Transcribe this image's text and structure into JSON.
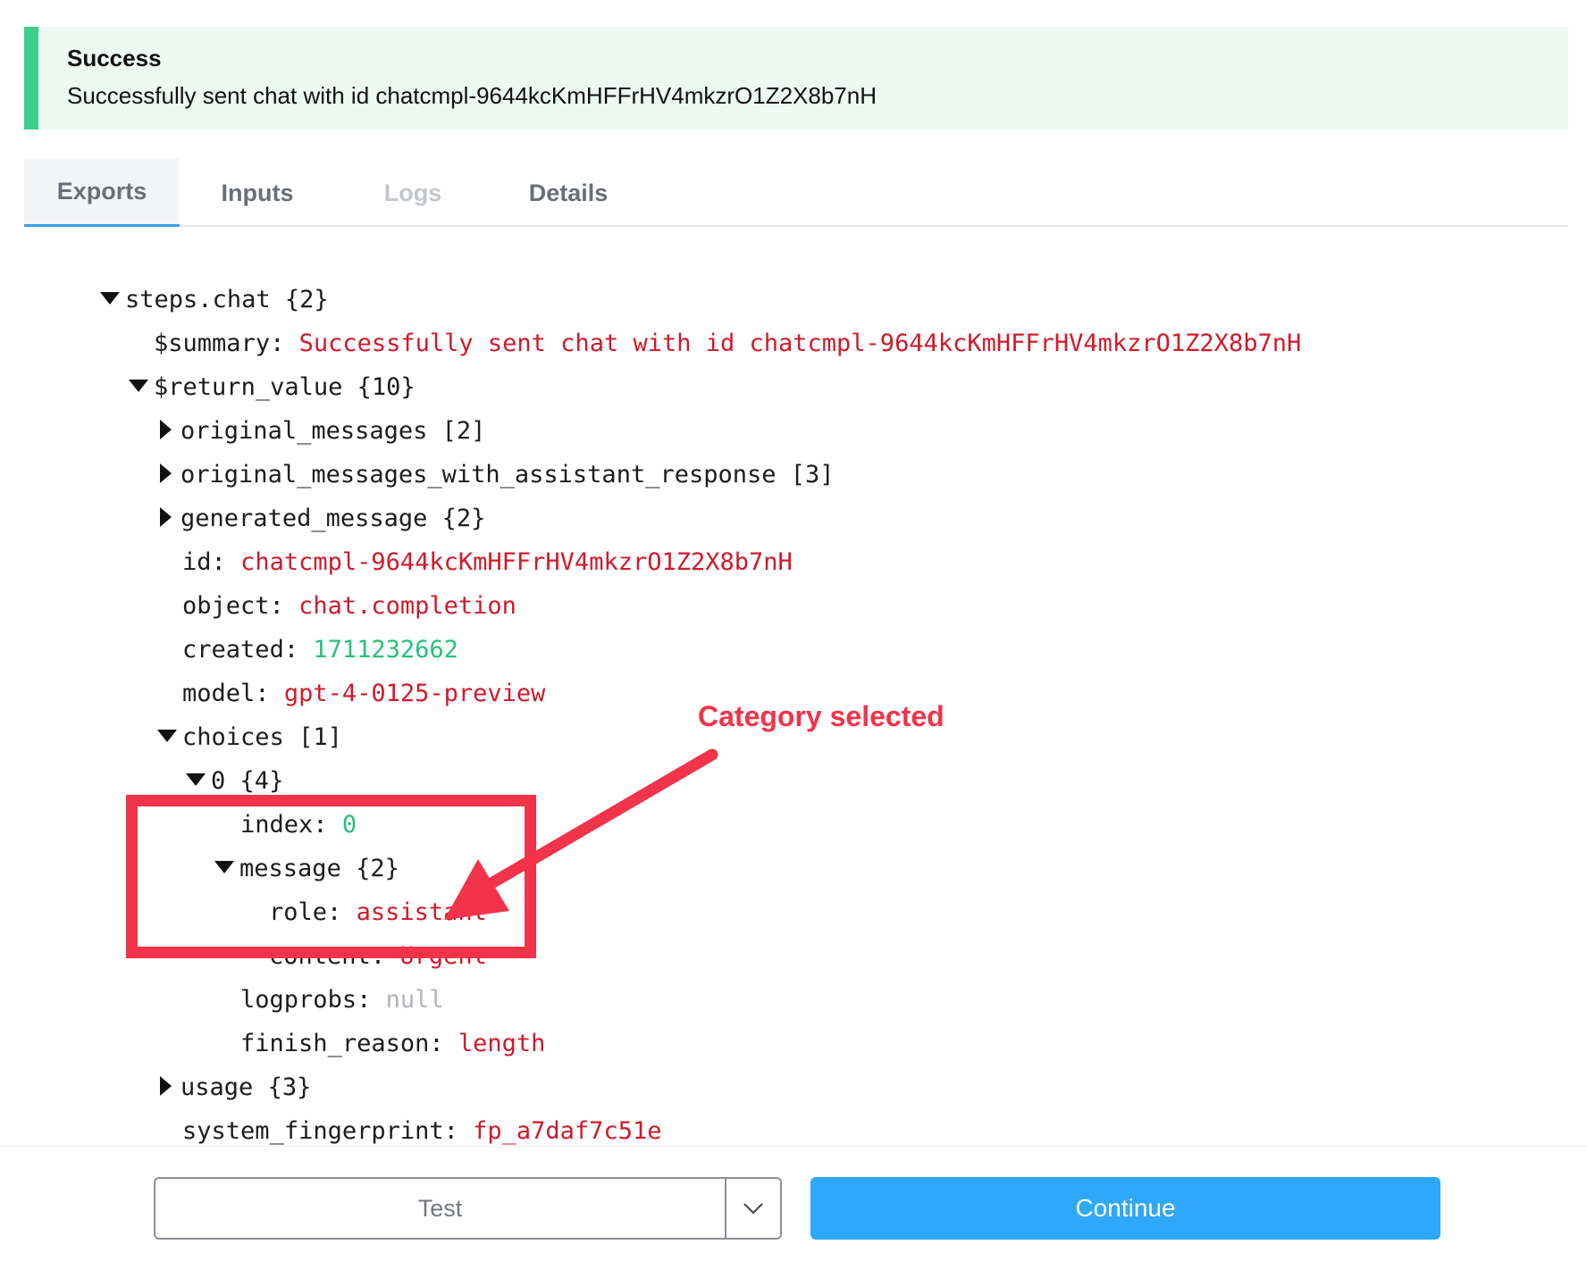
{
  "banner": {
    "title": "Success",
    "message": "Successfully sent chat with id chatcmpl-9644kcKmHFFrHV4mkzrO1Z2X8b7nH",
    "accent_color": "#3ccf8a"
  },
  "tabs": [
    {
      "label": "Exports",
      "state": "active"
    },
    {
      "label": "Inputs",
      "state": "normal"
    },
    {
      "label": "Logs",
      "state": "disabled"
    },
    {
      "label": "Details",
      "state": "normal"
    }
  ],
  "tree": {
    "root": {
      "key": "steps.chat",
      "count": " {2}"
    },
    "summary": {
      "key": "$summary: ",
      "value": "Successfully sent chat with id chatcmpl-9644kcKmHFFrHV4mkzrO1Z2X8b7nH"
    },
    "return_value": {
      "key": "$return_value",
      "count": " {10}"
    },
    "original_messages": {
      "key": "original_messages",
      "count": " [2]"
    },
    "original_messages_with_assistant_response": {
      "key": "original_messages_with_assistant_response",
      "count": " [3]"
    },
    "generated_message": {
      "key": "generated_message",
      "count": " {2}"
    },
    "id": {
      "key": "id: ",
      "value": "chatcmpl-9644kcKmHFFrHV4mkzrO1Z2X8b7nH"
    },
    "object": {
      "key": "object: ",
      "value": "chat.completion"
    },
    "created": {
      "key": "created: ",
      "value": "1711232662"
    },
    "model": {
      "key": "model: ",
      "value": "gpt-4-0125-preview"
    },
    "choices": {
      "key": "choices",
      "count": " [1]"
    },
    "choice0": {
      "key": "0",
      "count": " {4}"
    },
    "index": {
      "key": "index: ",
      "value": "0"
    },
    "message": {
      "key": "message",
      "count": " {2}"
    },
    "role": {
      "key": "role: ",
      "value": "assistant"
    },
    "content": {
      "key": "content: ",
      "value": "Urgent"
    },
    "logprobs": {
      "key": "logprobs: ",
      "value": "null"
    },
    "finish_reason": {
      "key": "finish_reason: ",
      "value": "length"
    },
    "usage": {
      "key": "usage",
      "count": " {3}"
    },
    "system_fingerprint": {
      "key": "system_fingerprint: ",
      "value": "fp_a7daf7c51e"
    }
  },
  "annotation": {
    "text": "Category selected",
    "color": "#f2334a"
  },
  "footer": {
    "test_label": "Test",
    "continue_label": "Continue",
    "continue_color": "#2ea8f9"
  },
  "icons": {
    "expanded": "triangle-down-icon",
    "collapsed": "triangle-right-icon",
    "dropdown": "chevron-down-icon"
  }
}
